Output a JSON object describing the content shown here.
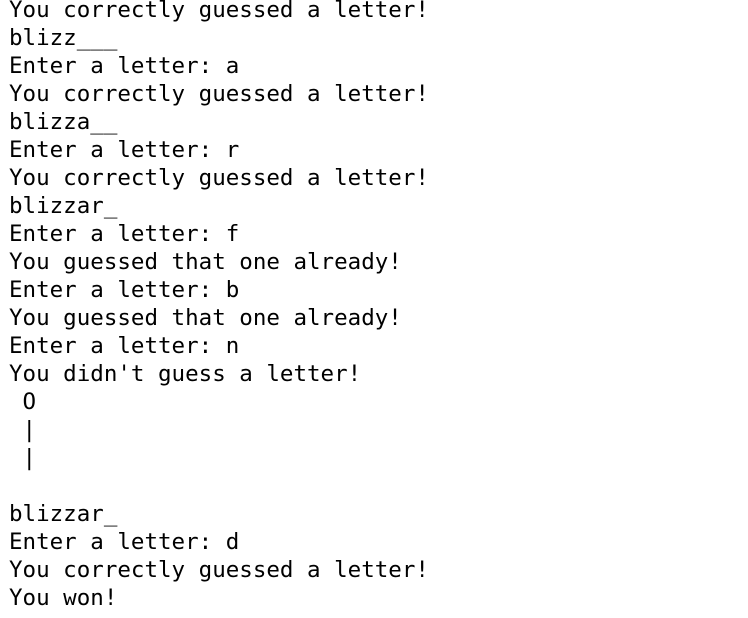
{
  "terminal": {
    "lines": [
      "You correctly guessed a letter!",
      "blizz___",
      "Enter a letter: a",
      "You correctly guessed a letter!",
      "blizza__",
      "Enter a letter: r",
      "You correctly guessed a letter!",
      "blizzar_",
      "Enter a letter: f",
      "You guessed that one already!",
      "Enter a letter: b",
      "You guessed that one already!",
      "Enter a letter: n",
      "You didn't guess a letter!",
      " O",
      " |",
      " |",
      "",
      "blizzar_",
      "Enter a letter: d",
      "You correctly guessed a letter!",
      "You won!"
    ]
  }
}
